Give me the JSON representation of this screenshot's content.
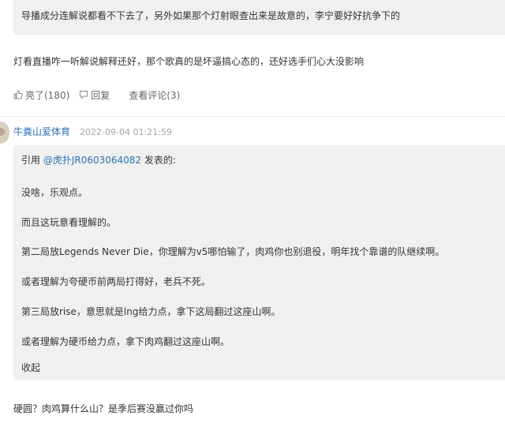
{
  "top_quote_text": "导播成分连解说都看不下去了，另外如果那个灯射眼查出来是故意的，李宁要好好抗争下的",
  "reply_text": "灯看直播咋一听解说解释还好，那个歌真的是坏逼搞心态的，还好选手们心大没影响",
  "actions": {
    "like_label": "亮了(180)",
    "reply_label": "回复",
    "comments_label": "查看评论(3)"
  },
  "post": {
    "username": "牛粪山爱体育",
    "timestamp": "2022-09-04 01:21:59",
    "quote": {
      "prefix": "引用 ",
      "link_text": "@虎扑JR0603064082",
      "suffix": " 发表的:",
      "lines": [
        "没啥，乐观点。",
        "而且这玩意看理解的。",
        "第二局放Legends Never Die，你理解为v5哪怕输了，肉鸡你也别退役，明年找个靠谱的队继续啊。",
        "或者理解为夸硬币前两局打得好，老兵不死。",
        "第三局放rise，意思就是lng给力点，拿下这局翻过这座山啊。",
        "或者理解为硬币给力点，拿下肉鸡翻过这座山啊。"
      ],
      "collapse_label": "收起"
    },
    "body": "硬圆？肉鸡算什么山？是季后赛没赢过你吗"
  },
  "icons": [
    "thumbs-up-icon",
    "reply-icon",
    "avatar"
  ],
  "colors": {
    "link": "#2f6fb3",
    "quote_bg": "#f0f0f0"
  }
}
